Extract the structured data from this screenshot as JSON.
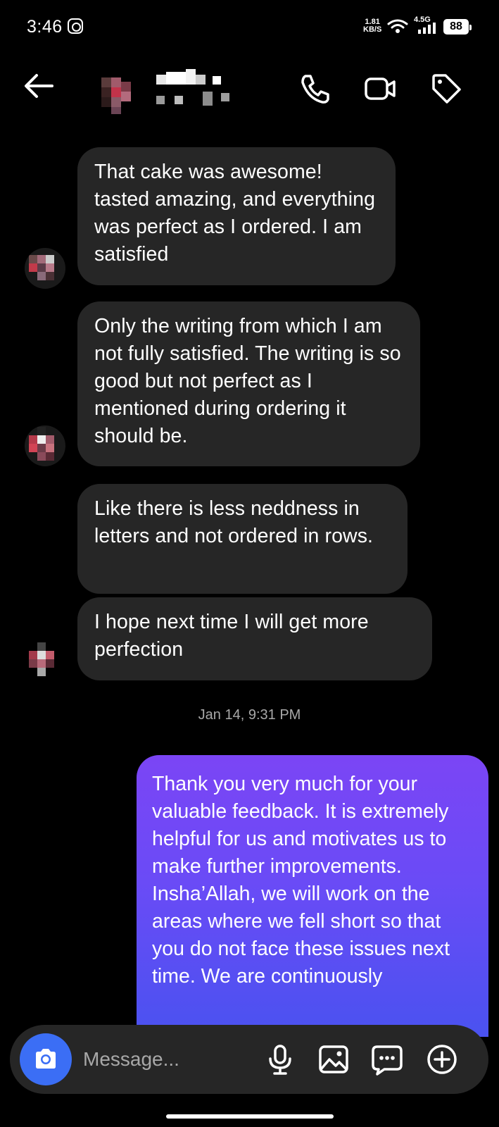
{
  "status_bar": {
    "time": "3:46",
    "speed_value": "1.81",
    "speed_unit": "KB/S",
    "network": "4.5G",
    "battery": "88"
  },
  "header": {
    "icons": [
      "back-arrow-icon",
      "phone-icon",
      "video-icon",
      "tag-icon"
    ]
  },
  "messages": [
    {
      "id": "m1",
      "text": "That cake was awesome! tasted amazing, and everything was perfect as I ordered. I am satisfied"
    },
    {
      "id": "m2",
      "text": "Only the writing from which I am not fully satisfied. The writing is so good but not perfect as I mentioned during ordering it should be."
    },
    {
      "id": "m3",
      "text": "Like there is less neddness in letters and  not ordered in rows."
    },
    {
      "id": "m4",
      "text": "I hope next time I will get more perfection"
    }
  ],
  "timestamp": "Jan 14, 9:31 PM",
  "outgoing": {
    "text": "Thank you very much for your valuable feedback. It is extremely helpful for us and motivates us to make further improvements. Insha’Allah, we will work on the areas where we fell short so that you do not face these issues next time. We are continuously"
  },
  "composer": {
    "placeholder": "Message...",
    "icons": [
      "camera-icon",
      "microphone-icon",
      "gallery-icon",
      "sticker-icon",
      "plus-icon"
    ]
  },
  "colors": {
    "background": "#000000",
    "incoming_bubble": "#262626",
    "outgoing_gradient_top": "#7b45f5",
    "outgoing_gradient_bottom": "#4a52f0",
    "camera_button": "#3b6ef5"
  }
}
